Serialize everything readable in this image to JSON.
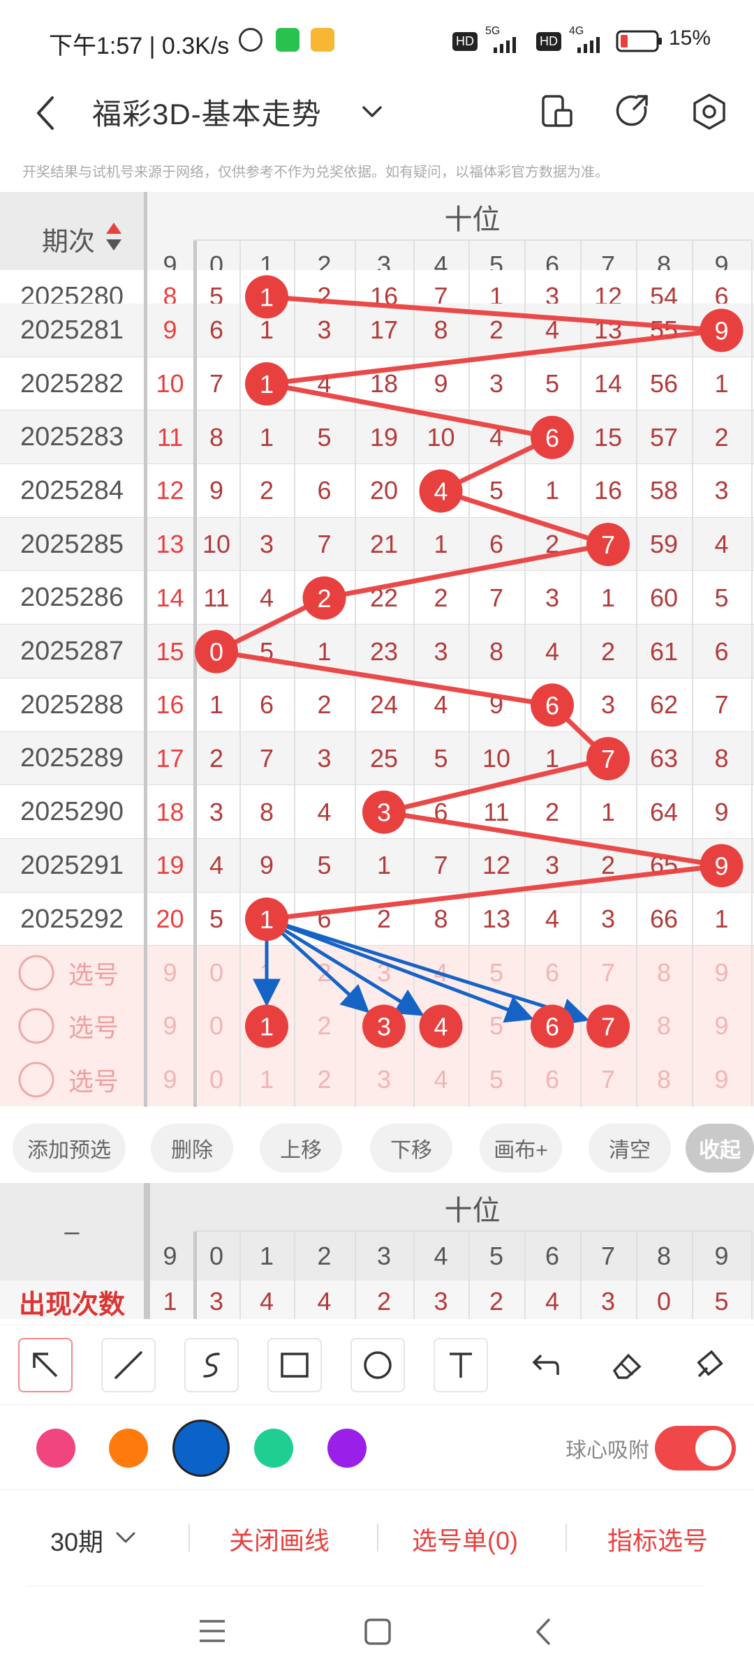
{
  "status_bar": {
    "time": "下午1:57 | 0.3K/s",
    "hd1": "HD",
    "net1": "5G",
    "hd2": "HD",
    "net2": "4G",
    "battery": "15%"
  },
  "header": {
    "title": "福彩3D-基本走势"
  },
  "notice": "开奖结果与试机号来源于网络，仅供参考不作为兑奖依据。如有疑问，以福体彩官方数据为准。",
  "table": {
    "period_header": "期次",
    "group_header": "十位",
    "columns": [
      "9",
      "0",
      "1",
      "2",
      "3",
      "4",
      "5",
      "6",
      "7",
      "8",
      "9"
    ],
    "partial_row": {
      "period": "2025280",
      "values": [
        "8",
        "5",
        "1",
        "2",
        "16",
        "7",
        "1",
        "3",
        "12",
        "54",
        "6"
      ],
      "ball_index": 2
    },
    "rows": [
      {
        "period": "2025281",
        "values": [
          "9",
          "6",
          "1",
          "3",
          "17",
          "8",
          "2",
          "4",
          "13",
          "55",
          "9"
        ],
        "ball_index": 10
      },
      {
        "period": "2025282",
        "values": [
          "10",
          "7",
          "1",
          "4",
          "18",
          "9",
          "3",
          "5",
          "14",
          "56",
          "1"
        ],
        "ball_index": 2
      },
      {
        "period": "2025283",
        "values": [
          "11",
          "8",
          "1",
          "5",
          "19",
          "10",
          "4",
          "6",
          "15",
          "57",
          "2"
        ],
        "ball_index": 7
      },
      {
        "period": "2025284",
        "values": [
          "12",
          "9",
          "2",
          "6",
          "20",
          "4",
          "5",
          "1",
          "16",
          "58",
          "3"
        ],
        "ball_index": 5
      },
      {
        "period": "2025285",
        "values": [
          "13",
          "10",
          "3",
          "7",
          "21",
          "1",
          "6",
          "2",
          "7",
          "59",
          "4"
        ],
        "ball_index": 8
      },
      {
        "period": "2025286",
        "values": [
          "14",
          "11",
          "4",
          "2",
          "22",
          "2",
          "7",
          "3",
          "1",
          "60",
          "5"
        ],
        "ball_index": 3
      },
      {
        "period": "2025287",
        "values": [
          "15",
          "0",
          "5",
          "1",
          "23",
          "3",
          "8",
          "4",
          "2",
          "61",
          "6"
        ],
        "ball_index": 1
      },
      {
        "period": "2025288",
        "values": [
          "16",
          "1",
          "6",
          "2",
          "24",
          "4",
          "9",
          "6",
          "3",
          "62",
          "7"
        ],
        "ball_index": 7
      },
      {
        "period": "2025289",
        "values": [
          "17",
          "2",
          "7",
          "3",
          "25",
          "5",
          "10",
          "1",
          "7",
          "63",
          "8"
        ],
        "ball_index": 8
      },
      {
        "period": "2025290",
        "values": [
          "18",
          "3",
          "8",
          "4",
          "3",
          "6",
          "11",
          "2",
          "1",
          "64",
          "9"
        ],
        "ball_index": 4
      },
      {
        "period": "2025291",
        "values": [
          "19",
          "4",
          "9",
          "5",
          "1",
          "7",
          "12",
          "3",
          "2",
          "65",
          "9"
        ],
        "ball_index": 10
      },
      {
        "period": "2025292",
        "values": [
          "20",
          "5",
          "1",
          "6",
          "2",
          "8",
          "13",
          "4",
          "3",
          "66",
          "1"
        ],
        "ball_index": 2
      }
    ],
    "select_label": "选号",
    "select_rows": [
      {
        "values": [
          "9",
          "0",
          "1",
          "2",
          "3",
          "4",
          "5",
          "6",
          "7",
          "8",
          "9"
        ],
        "balls": []
      },
      {
        "values": [
          "9",
          "0",
          "1",
          "2",
          "3",
          "4",
          "5",
          "6",
          "7",
          "8",
          "9"
        ],
        "balls": [
          2,
          4,
          5,
          7,
          8
        ]
      },
      {
        "values": [
          "9",
          "0",
          "1",
          "2",
          "3",
          "4",
          "5",
          "6",
          "7",
          "8",
          "9"
        ],
        "balls": []
      }
    ]
  },
  "actions": [
    "添加预选",
    "删除",
    "上移",
    "下移",
    "画布+",
    "清空",
    "收起"
  ],
  "stats": {
    "corner": "–",
    "group_header": "十位",
    "columns": [
      "9",
      "0",
      "1",
      "2",
      "3",
      "4",
      "5",
      "6",
      "7",
      "8",
      "9"
    ],
    "row_label": "出现次数",
    "values": [
      "1",
      "3",
      "4",
      "4",
      "2",
      "3",
      "2",
      "4",
      "3",
      "0",
      "5"
    ]
  },
  "tools": [
    "select-arrow-icon",
    "line-icon",
    "curve-icon",
    "rectangle-icon",
    "circle-icon",
    "text-icon",
    "undo-icon",
    "eraser-icon",
    "clear-brush-icon"
  ],
  "colors": [
    "#f0457f",
    "#ff7a0d",
    "#0b63c9",
    "#1fcf92",
    "#9a1fe8"
  ],
  "snap_label": "球心吸附",
  "snap_on": true,
  "bottom": {
    "periods": "30期",
    "close_lines": "关闭画线",
    "selection": "选号单(0)",
    "indicator": "指标选号"
  },
  "theme": {
    "red": "#e8403f",
    "blue": "#1663c6",
    "select_bg": "#fdecea"
  }
}
